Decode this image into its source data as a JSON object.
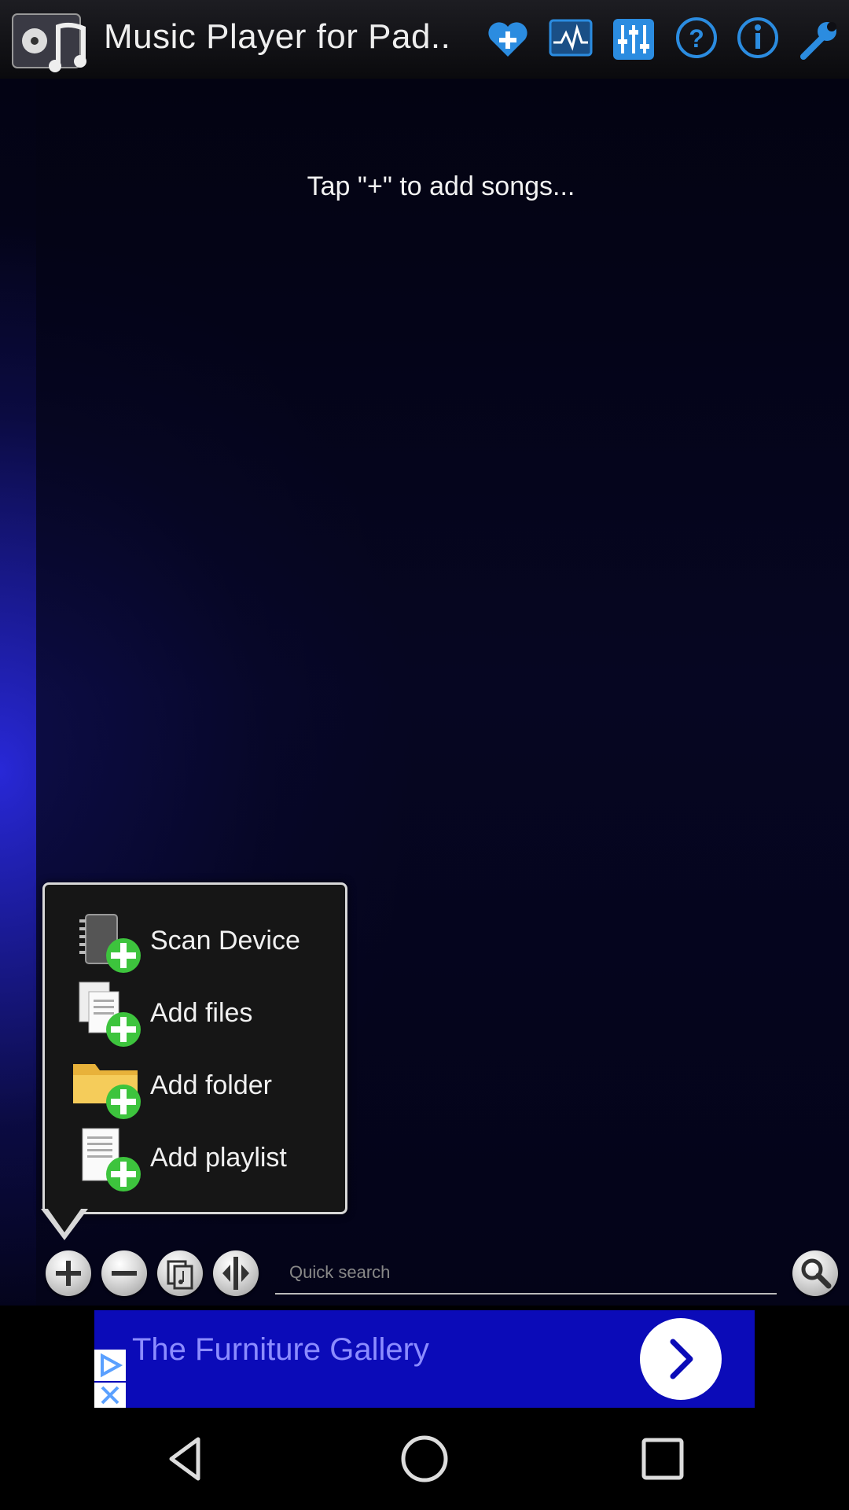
{
  "app": {
    "title": "Music Player for Pad.."
  },
  "toolbar_icons": [
    "favorite-add-icon",
    "visualizer-icon",
    "equalizer-icon",
    "help-icon",
    "info-icon",
    "settings-wrench-icon"
  ],
  "playlist": {
    "empty_hint": "Tap \"+\" to add songs..."
  },
  "add_menu": {
    "items": [
      {
        "label": "Scan Device",
        "icon": "scan-device-icon"
      },
      {
        "label": "Add files",
        "icon": "add-files-icon"
      },
      {
        "label": "Add folder",
        "icon": "add-folder-icon"
      },
      {
        "label": "Add playlist",
        "icon": "add-playlist-icon"
      }
    ]
  },
  "bottom_bar": {
    "buttons": [
      "add-icon",
      "remove-icon",
      "copy-music-icon",
      "sort-icon"
    ],
    "search_placeholder": "Quick search"
  },
  "ad": {
    "text": "The Furniture Gallery"
  },
  "colors": {
    "accent_blue": "#2a2ad0",
    "ad_blue": "#0b0bb8",
    "plus_green": "#3dc43d",
    "toolbar_icon_blue": "#2b8ce0"
  }
}
